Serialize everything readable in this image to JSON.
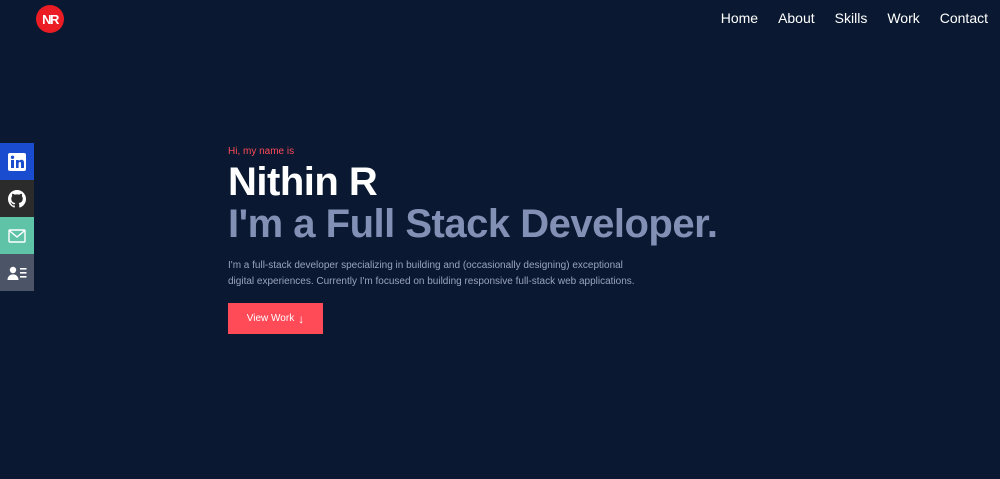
{
  "logo": {
    "text": "NR",
    "color": "#ec1c24"
  },
  "nav": {
    "items": [
      "Home",
      "About",
      "Skills",
      "Work",
      "Contact"
    ]
  },
  "social": {
    "items": [
      {
        "icon": "linkedin-icon",
        "color": "#1a4ccf"
      },
      {
        "icon": "github-icon",
        "color": "#2b2b2b"
      },
      {
        "icon": "mail-icon",
        "color": "#5fc3a8"
      },
      {
        "icon": "contact-card-icon",
        "color": "#4c5468"
      }
    ]
  },
  "hero": {
    "greeting": "Hi, my name is",
    "name": "Nithin R",
    "role": "I'm a Full Stack Developer.",
    "description_line1": "I'm a full-stack developer specializing in building and (occasionally designing) exceptional",
    "description_line2": "digital experiences. Currently I'm focused on building responsive full-stack web applications.",
    "button_label": "View Work",
    "button_icon": "arrow-down-icon"
  },
  "colors": {
    "background": "#0a1931",
    "accent": "#ff4a57",
    "role_text": "#8390b5"
  }
}
